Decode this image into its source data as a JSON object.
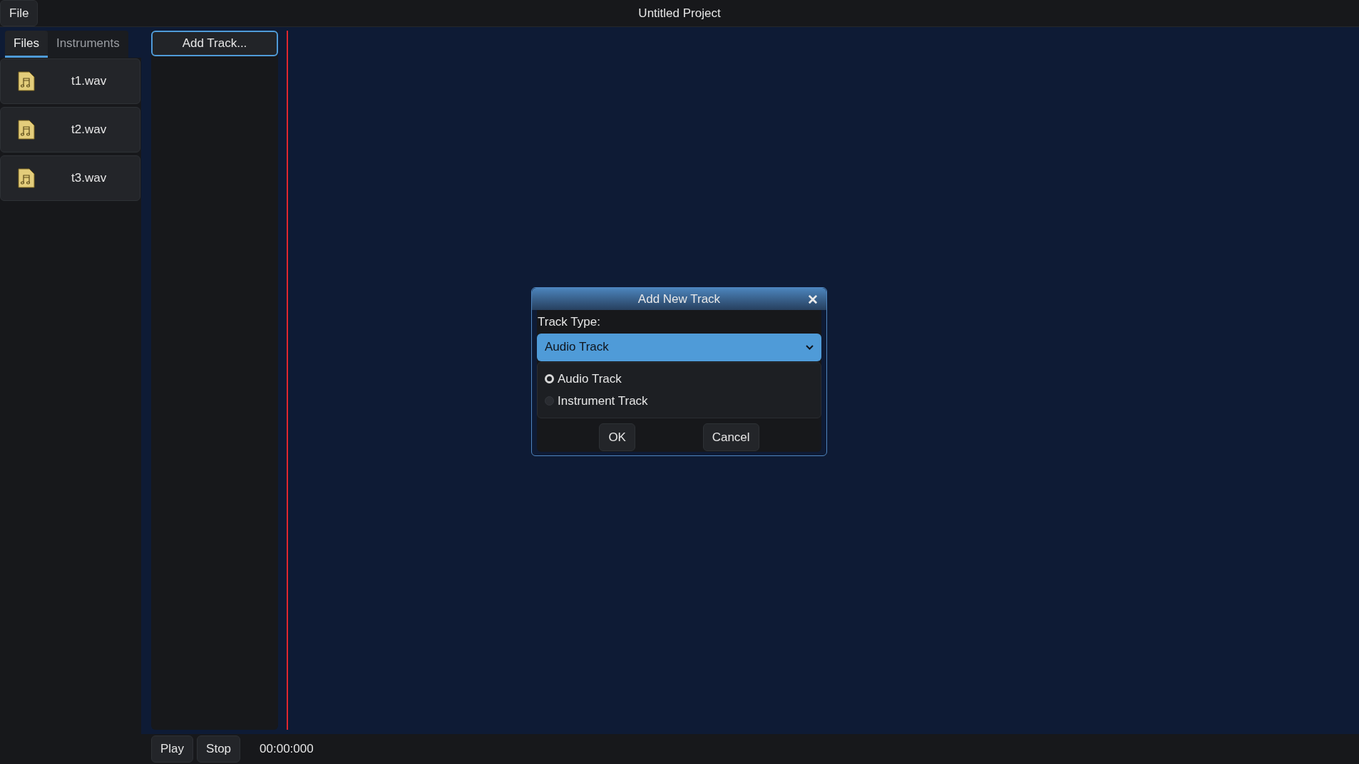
{
  "menu": [
    "File"
  ],
  "window": {
    "title": "Untitled Project"
  },
  "tabs": [
    {
      "label": "Files",
      "selected": true
    },
    {
      "label": "Instruments",
      "selected": false
    }
  ],
  "files": [
    {
      "name": "t1.wav"
    },
    {
      "name": "t2.wav"
    },
    {
      "name": "t3.wav"
    }
  ],
  "add_track_button": "Add Track...",
  "transport": {
    "buttons": [
      "Play",
      "Stop"
    ],
    "time": "00:00:000"
  },
  "dialog": {
    "title": "Add New Track",
    "close": "✕",
    "label": "Track Type:",
    "value": "Audio Track",
    "options": [
      {
        "label": "Audio Track",
        "selected": true
      },
      {
        "label": "Instrument Track",
        "selected": false
      }
    ],
    "buttons": [
      "OK",
      "Cancel"
    ]
  }
}
